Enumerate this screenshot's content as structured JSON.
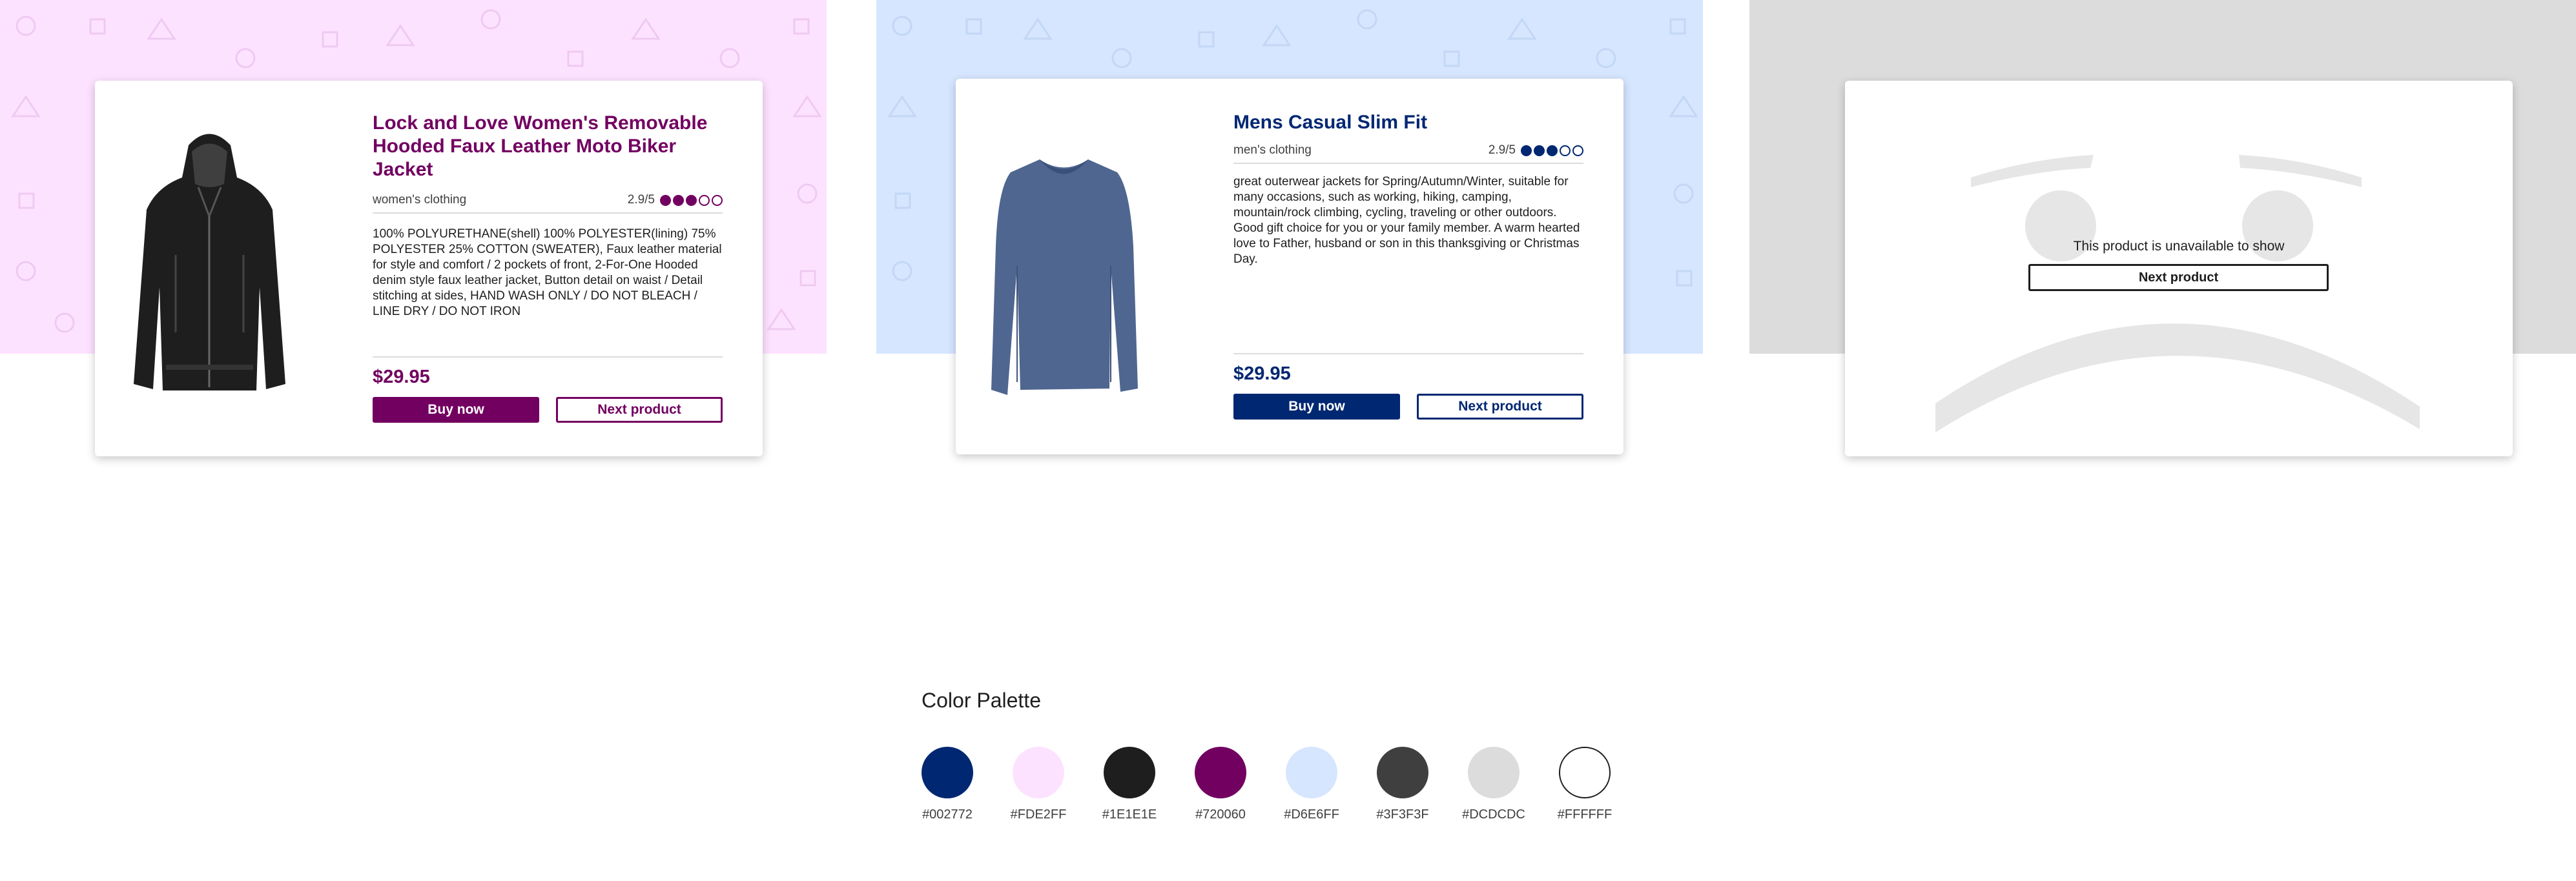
{
  "colors": {
    "navy": "#002772",
    "pink_bg": "#FDE2FF",
    "dark": "#1E1E1E",
    "purple": "#720060",
    "blue_bg": "#D6E6FF",
    "grey_dark": "#3F3F3F",
    "grey_bg": "#DCDCDC",
    "white": "#FFFFFF"
  },
  "cards": {
    "women": {
      "title_line1": "Lock and Love Women's Removable",
      "title_line2": "Hooded Faux Leather Moto Biker Jacket",
      "category": "women's clothing",
      "rating_text": "2.9/5",
      "rating_value": 2.9,
      "rating_max": 5,
      "description": "100% POLYURETHANE(shell) 100% POLYESTER(lining) 75% POLYESTER 25% COTTON (SWEATER), Faux leather material for style and comfort / 2 pockets of front, 2-For-One Hooded denim style faux leather jacket, Button detail on waist / Detail stitching at sides, HAND WASH ONLY / DO NOT BLEACH / LINE DRY / DO NOT IRON",
      "price": "$29.95",
      "buy_label": "Buy now",
      "next_label": "Next product",
      "image_icon": "leather-jacket-image"
    },
    "men": {
      "title": "Mens Casual Slim Fit",
      "category": "men's clothing",
      "rating_text": "2.9/5",
      "rating_value": 2.9,
      "rating_max": 5,
      "description": "great outerwear jackets for Spring/Autumn/Winter, suitable for many occasions, such as working, hiking, camping, mountain/rock climbing, cycling, traveling or other outdoors. Good gift choice for you or your family member. A warm hearted love to Father, husband or son in this thanksgiving or Christmas Day.",
      "price": "$29.95",
      "buy_label": "Buy now",
      "next_label": "Next product",
      "image_icon": "long-sleeve-shirt-image"
    },
    "unavailable": {
      "message": "This product is unavailable to show",
      "next_label": "Next product",
      "image_icon": "sad-face-icon"
    }
  },
  "palette": {
    "title": "Color Palette",
    "swatches": [
      {
        "hex": "#002772",
        "label": "#002772"
      },
      {
        "hex": "#FDE2FF",
        "label": "#FDE2FF"
      },
      {
        "hex": "#1E1E1E",
        "label": "#1E1E1E"
      },
      {
        "hex": "#720060",
        "label": "#720060"
      },
      {
        "hex": "#D6E6FF",
        "label": "#D6E6FF"
      },
      {
        "hex": "#3F3F3F",
        "label": "#3F3F3F"
      },
      {
        "hex": "#DCDCDC",
        "label": "#DCDCDC"
      },
      {
        "hex": "#FFFFFF",
        "label": "#FFFFFF"
      }
    ]
  }
}
